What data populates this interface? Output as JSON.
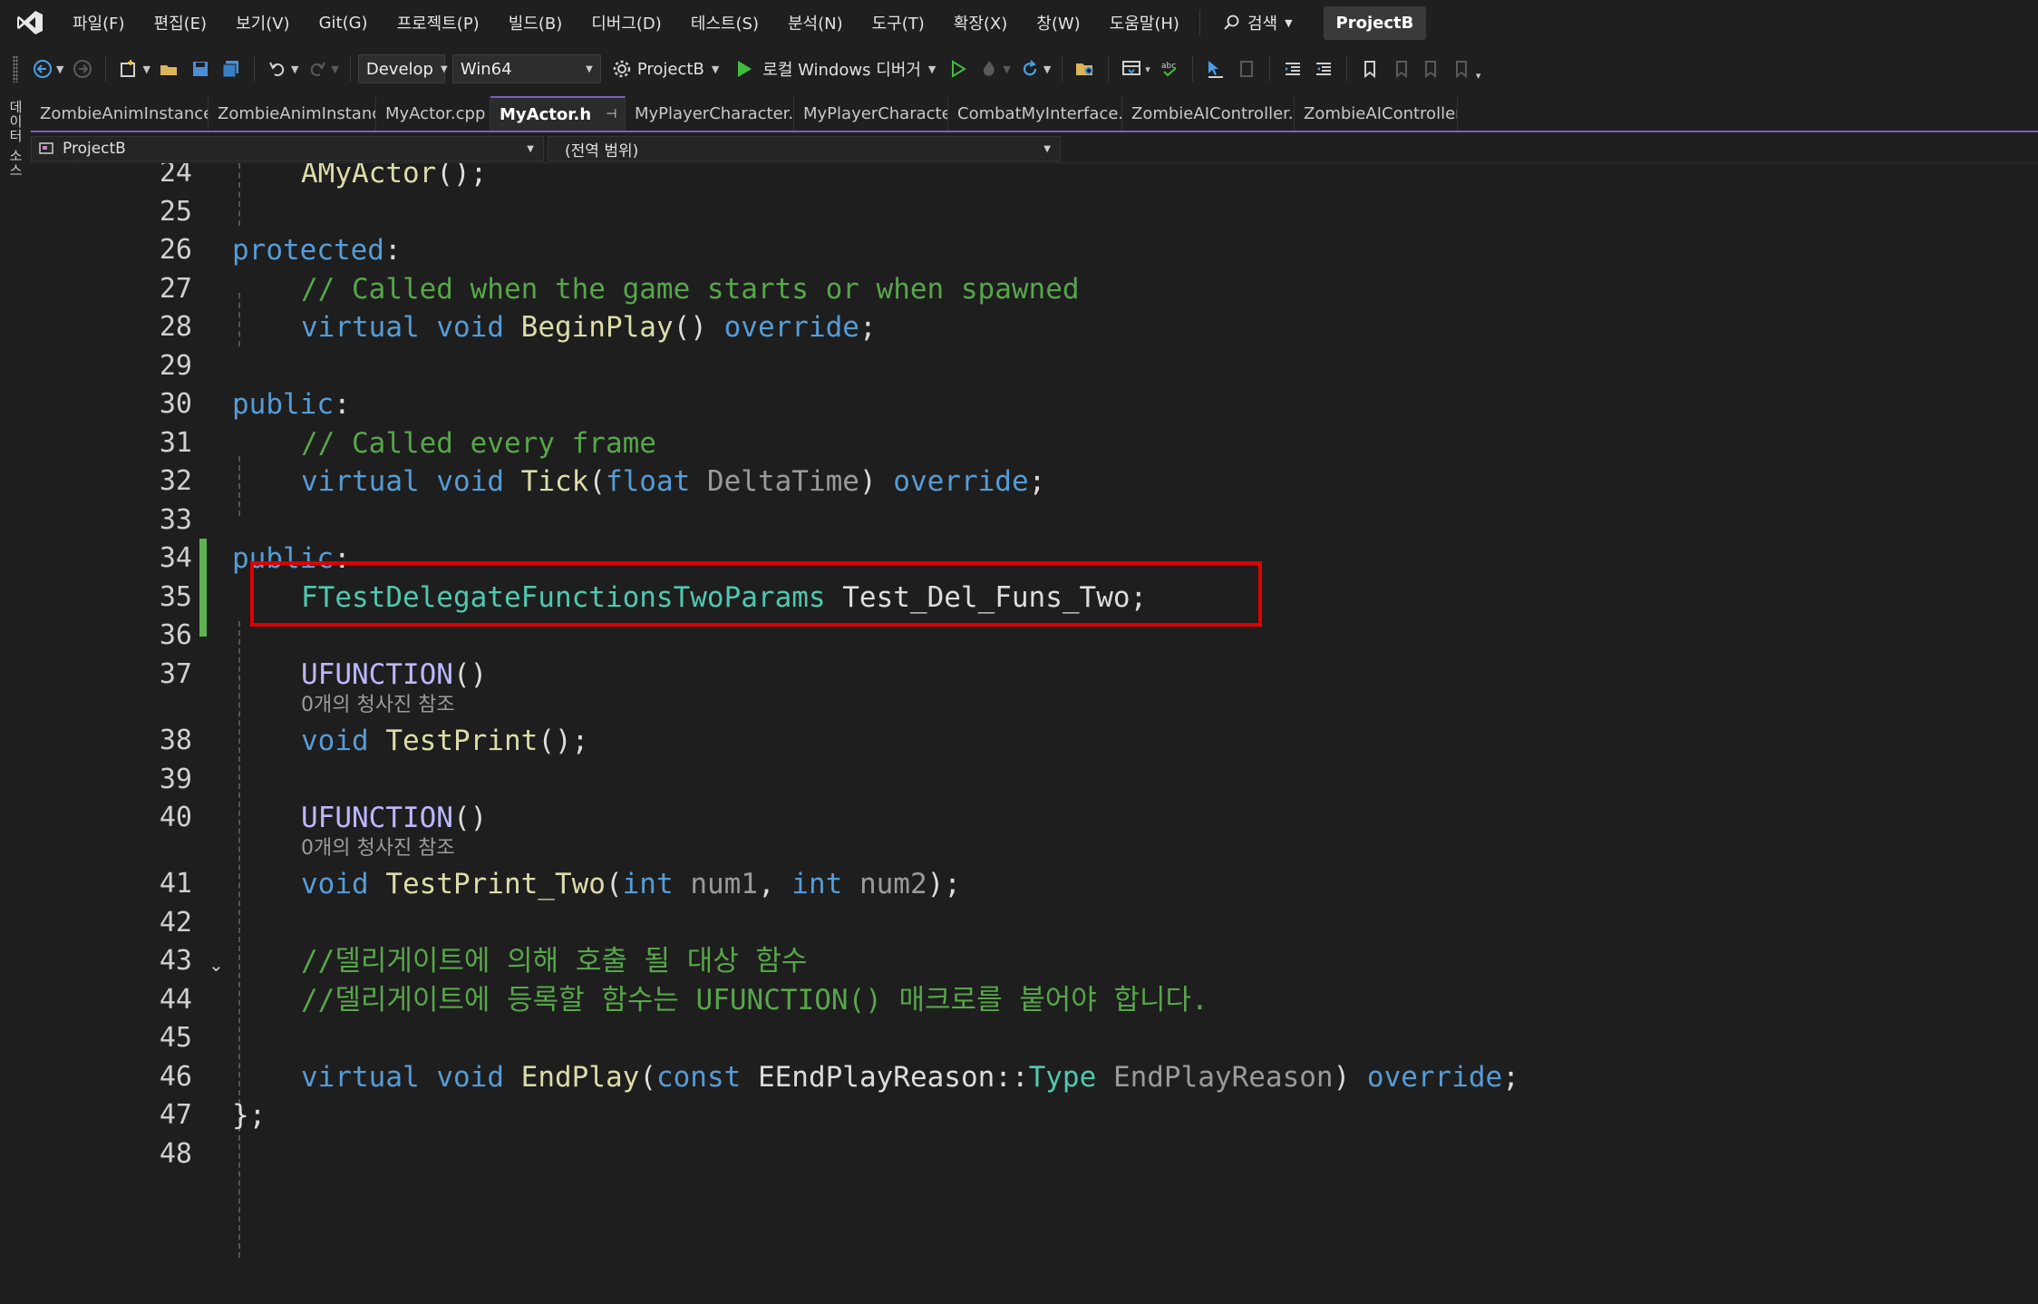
{
  "menubar": {
    "items": [
      "파일(F)",
      "편집(E)",
      "보기(V)",
      "Git(G)",
      "프로젝트(P)",
      "빌드(B)",
      "디버그(D)",
      "테스트(S)",
      "분석(N)",
      "도구(T)",
      "확장(X)",
      "창(W)",
      "도움말(H)"
    ],
    "search_label": "검색",
    "project_name": "ProjectB"
  },
  "toolbar": {
    "configuration": "Develop",
    "platform": "Win64",
    "startup_project": "ProjectB",
    "debugger_label": "로컬 Windows 디버거"
  },
  "siderail": {
    "label": "데이터 소스"
  },
  "tabs": [
    {
      "label": "ZombieAnimInstance.cpp",
      "active": false
    },
    {
      "label": "ZombieAnimInstance.h",
      "active": false
    },
    {
      "label": "MyActor.cpp",
      "active": false
    },
    {
      "label": "MyActor.h",
      "active": true
    },
    {
      "label": "MyPlayerCharacter.cpp",
      "active": false
    },
    {
      "label": "MyPlayerCharacter.h",
      "active": false
    },
    {
      "label": "CombatMyInterface.cpp",
      "active": false
    },
    {
      "label": "ZombieAIController.cpp",
      "active": false
    },
    {
      "label": "ZombieAIController.h",
      "active": false
    }
  ],
  "navbar": {
    "project": "ProjectB",
    "scope": "(전역 범위)"
  },
  "editor": {
    "line_numbers": [
      "24",
      "25",
      "26",
      "27",
      "28",
      "29",
      "30",
      "31",
      "32",
      "33",
      "34",
      "35",
      "36",
      "37",
      "38",
      "39",
      "40",
      "41",
      "42",
      "43",
      "44",
      "45",
      "46",
      "47",
      "48"
    ],
    "codelens": "0개의 청사진 참조",
    "code": {
      "l24_fn": "AMyActor",
      "l24_rest": "();",
      "l26_kw": "protected",
      "l27_cmt": "// Called when the game starts or when spawned",
      "l28_kw1": "virtual",
      "l28_kw2": "void",
      "l28_fn": "BeginPlay",
      "l28_kw3": "override",
      "l30_kw": "public",
      "l31_cmt": "// Called every frame",
      "l32_kw1": "virtual",
      "l32_kw2": "void",
      "l32_fn": "Tick",
      "l32_kw3": "float",
      "l32_prm": "DeltaTime",
      "l32_kw4": "override",
      "l34_kw": "public",
      "l35_typ": "FTestDelegateFunctionsTwoParams",
      "l35_var": "Test_Del_Funs_Two",
      "l37_mac": "UFUNCTION",
      "l38_kw": "void",
      "l38_fn": "TestPrint",
      "l40_mac": "UFUNCTION",
      "l41_kw": "void",
      "l41_fn": "TestPrint_Two",
      "l41_kw2": "int",
      "l41_prm1": "num1",
      "l41_kw3": "int",
      "l41_prm2": "num2",
      "l43_cmt": "//델리게이트에 의해 호출 될 대상 함수",
      "l44_cmt": "//델리게이트에 등록할 함수는 UFUNCTION() 매크로를 붙어야 합니다.",
      "l46_kw1": "virtual",
      "l46_kw2": "void",
      "l46_fn": "EndPlay",
      "l46_kw3": "const",
      "l46_typ1": "EEndPlayReason",
      "l46_typ2": "Type",
      "l46_prm": "EndPlayReason",
      "l46_kw4": "override",
      "l47_close": "};"
    }
  },
  "colors": {
    "keyword": "#569cd6",
    "comment": "#57a64a",
    "function": "#dcdcaa",
    "type": "#4ec9b0",
    "macro": "#beb7ff",
    "highlight_box": "#e00000",
    "change_bar": "#5bb450",
    "tab_accent": "#7c5cc4"
  }
}
